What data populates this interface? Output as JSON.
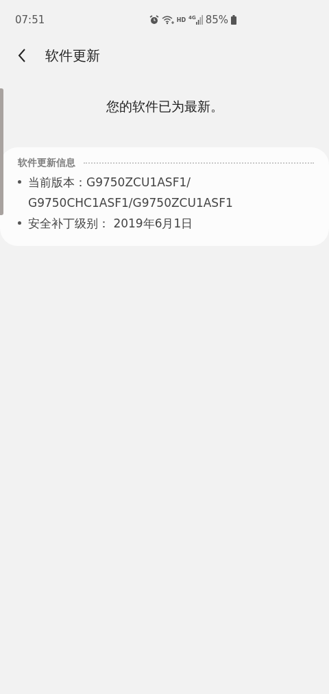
{
  "status_bar": {
    "time": "07:51",
    "hd": "HD",
    "network": "4G",
    "battery": "85%"
  },
  "header": {
    "title": "软件更新"
  },
  "message": "您的软件已为最新。",
  "info_card": {
    "title": "软件更新信息",
    "items": [
      "当前版本：G9750ZCU1ASF1/G9750CHC1ASF1/G9750ZCU1ASF1",
      "安全补丁级别： 2019年6月1日"
    ]
  }
}
